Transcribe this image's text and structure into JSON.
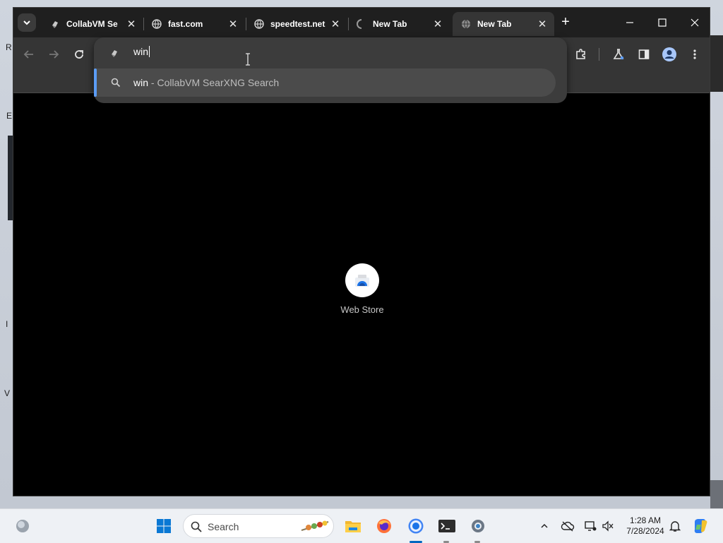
{
  "desktop": {
    "edge_fragments": [
      "R",
      "E",
      "I",
      "V"
    ]
  },
  "browser": {
    "tabs": [
      {
        "title": "CollabVM Se",
        "icon": "collabvm-icon",
        "close": "✕"
      },
      {
        "title": "fast.com",
        "icon": "globe-icon",
        "close": "✕"
      },
      {
        "title": "speedtest.net",
        "icon": "globe-icon",
        "close": "✕"
      },
      {
        "title": "New Tab",
        "icon": "loading-spinner-icon",
        "close": "✕"
      },
      {
        "title": "New Tab",
        "icon": "globe-icon",
        "close": "✕",
        "active": true
      }
    ],
    "new_tab_glyph": "+",
    "omnibox": {
      "typed_text": "win",
      "suggestion": {
        "query": "win",
        "separator": " - ",
        "engine": "CollabVM SearXNG Search"
      }
    },
    "content": {
      "shortcut_label": "Web Store"
    },
    "colors": {
      "accent": "#5b9cf5",
      "page_bg": "#000000",
      "toolbar_bg": "#353535"
    }
  },
  "taskbar": {
    "search_placeholder": "Search",
    "time": "1:28 AM",
    "date": "7/28/2024",
    "pinned": [
      "windows-start-icon",
      "file-explorer-icon",
      "firefox-icon",
      "chrome-icon",
      "terminal-icon",
      "settings-icon"
    ]
  }
}
